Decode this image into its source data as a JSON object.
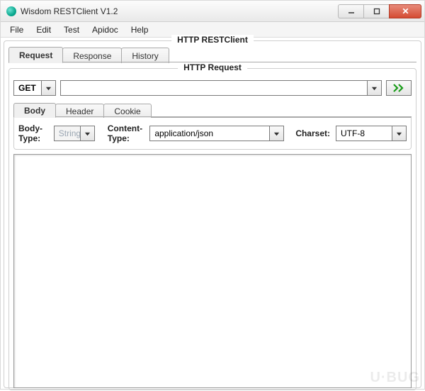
{
  "window": {
    "title": "Wisdom RESTClient V1.2"
  },
  "menu": {
    "file": "File",
    "edit": "Edit",
    "test": "Test",
    "apidoc": "Apidoc",
    "help": "Help"
  },
  "panel": {
    "main_title": "HTTP RESTClient",
    "tabs": {
      "request": "Request",
      "response": "Response",
      "history": "History"
    },
    "request_group_title": "HTTP Request"
  },
  "request": {
    "method": "GET",
    "url": "",
    "inner_tabs": {
      "body": "Body",
      "header": "Header",
      "cookie": "Cookie"
    },
    "body": {
      "body_type_label": "Body-Type:",
      "body_type_value": "String",
      "content_type_label": "Content-Type:",
      "content_type_value": "application/json",
      "charset_label": "Charset:",
      "charset_value": "UTF-8",
      "content": ""
    }
  },
  "watermark": "U·BUG"
}
